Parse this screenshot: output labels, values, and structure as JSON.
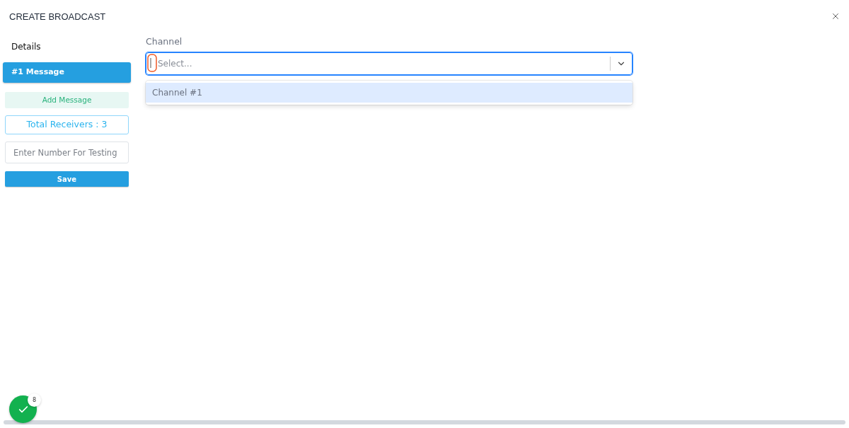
{
  "window": {
    "title": "CREATE BROADCAST"
  },
  "sidebar": {
    "heading": "Details",
    "messages": [
      {
        "label": "#1 Message",
        "selected": true
      }
    ],
    "add_button": "Add Message",
    "total_receivers": "Total Receivers : 3",
    "test_number": {
      "placeholder": "Enter Number For Testing"
    },
    "save_button": "Save"
  },
  "channel": {
    "label": "Channel",
    "select": {
      "placeholder": "Select...",
      "focused": true
    },
    "options": [
      {
        "label": "Channel #1",
        "selected": true
      }
    ]
  },
  "floating_button": {
    "badge": "8"
  }
}
